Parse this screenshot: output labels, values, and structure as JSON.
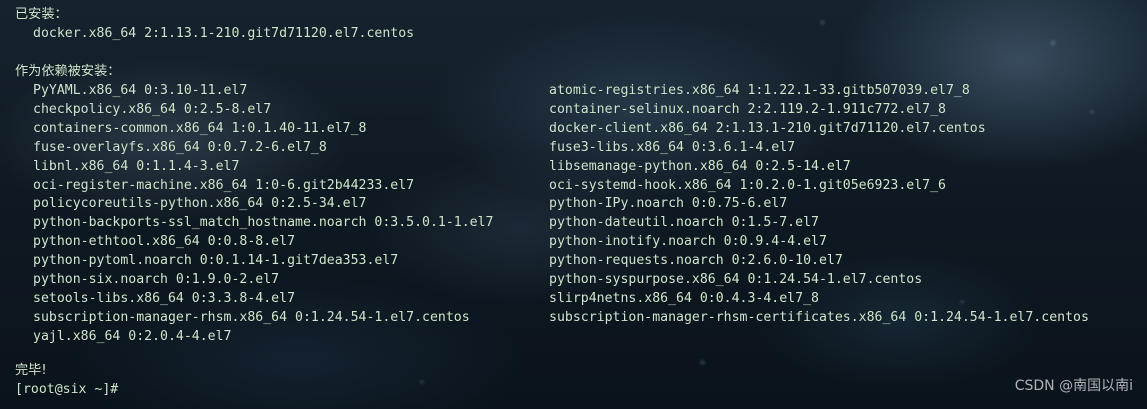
{
  "terminal": {
    "installed_header": "已安装：",
    "installed_pkg": "docker.x86_64 2:1.13.1-210.git7d71120.el7.centos",
    "deps_header": "作为依赖被安装：",
    "deps_left": [
      "PyYAML.x86_64 0:3.10-11.el7",
      "checkpolicy.x86_64 0:2.5-8.el7",
      "containers-common.x86_64 1:0.1.40-11.el7_8",
      "fuse-overlayfs.x86_64 0:0.7.2-6.el7_8",
      "libnl.x86_64 0:1.1.4-3.el7",
      "oci-register-machine.x86_64 1:0-6.git2b44233.el7",
      "policycoreutils-python.x86_64 0:2.5-34.el7",
      "python-backports-ssl_match_hostname.noarch 0:3.5.0.1-1.el7",
      "python-ethtool.x86_64 0:0.8-8.el7",
      "python-pytoml.noarch 0:0.1.14-1.git7dea353.el7",
      "python-six.noarch 0:1.9.0-2.el7",
      "setools-libs.x86_64 0:3.3.8-4.el7",
      "subscription-manager-rhsm.x86_64 0:1.24.54-1.el7.centos",
      "yajl.x86_64 0:2.0.4-4.el7"
    ],
    "deps_right": [
      "atomic-registries.x86_64 1:1.22.1-33.gitb507039.el7_8",
      "container-selinux.noarch 2:2.119.2-1.911c772.el7_8",
      "docker-client.x86_64 2:1.13.1-210.git7d71120.el7.centos",
      "fuse3-libs.x86_64 0:3.6.1-4.el7",
      "libsemanage-python.x86_64 0:2.5-14.el7",
      "oci-systemd-hook.x86_64 1:0.2.0-1.git05e6923.el7_6",
      "python-IPy.noarch 0:0.75-6.el7",
      "python-dateutil.noarch 0:1.5-7.el7",
      "python-inotify.noarch 0:0.9.4-4.el7",
      "python-requests.noarch 0:2.6.0-10.el7",
      "python-syspurpose.x86_64 0:1.24.54-1.el7.centos",
      "slirp4netns.x86_64 0:0.4.3-4.el7_8",
      "subscription-manager-rhsm-certificates.x86_64 0:1.24.54-1.el7.centos"
    ],
    "complete": "完毕!",
    "prompt": "[root@six ~]#"
  },
  "watermark": "CSDN @南国以南i",
  "colors": {
    "text": "#cfe8cf",
    "background": "#0d1a26"
  }
}
